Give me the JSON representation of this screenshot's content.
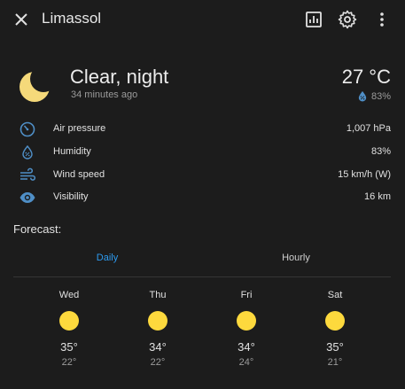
{
  "header": {
    "title": "Limassol"
  },
  "current": {
    "condition": "Clear, night",
    "updated": "34 minutes ago",
    "temperature": "27 °C",
    "humidity": "83%"
  },
  "attributes": [
    {
      "label": "Air pressure",
      "value": "1,007 hPa",
      "icon": "gauge-icon"
    },
    {
      "label": "Humidity",
      "value": "83%",
      "icon": "water-percent-icon"
    },
    {
      "label": "Wind speed",
      "value": "15 km/h (W)",
      "icon": "wind-icon"
    },
    {
      "label": "Visibility",
      "value": "16 km",
      "icon": "eye-icon"
    }
  ],
  "forecast": {
    "label": "Forecast:",
    "tabs": [
      "Daily",
      "Hourly"
    ],
    "active_tab": "Daily",
    "days": [
      {
        "name": "Wed",
        "high": "35°",
        "low": "22°",
        "icon": "sunny-icon"
      },
      {
        "name": "Thu",
        "high": "34°",
        "low": "22°",
        "icon": "sunny-icon"
      },
      {
        "name": "Fri",
        "high": "34°",
        "low": "24°",
        "icon": "sunny-icon"
      },
      {
        "name": "Sat",
        "high": "35°",
        "low": "21°",
        "icon": "sunny-icon"
      }
    ]
  },
  "colors": {
    "background": "#1c1c1c",
    "accent": "#2d9bf0",
    "icon_blue": "#4f8fc7",
    "moon": "#f5d97a",
    "sun": "#fdd93d"
  }
}
